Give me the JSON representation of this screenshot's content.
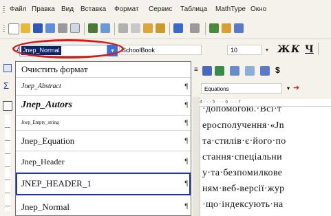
{
  "menu": [
    "Файл",
    "Правка",
    "Вид",
    "Вставка",
    "Формат",
    "Сервис",
    "Таблица",
    "MathType",
    "Окно"
  ],
  "format_bar": {
    "style_value": "Jnep_Normal",
    "font_value": "SchoolBook",
    "size_value": "10",
    "bold": "Ж",
    "italic": "К",
    "underline": "Ч"
  },
  "left_strip_glyph": "Σ",
  "style_list": [
    {
      "label": "Очистить формат",
      "mark": ""
    },
    {
      "label": "Jnep_Abstract",
      "mark": "¶"
    },
    {
      "label": "Jnep_Autors",
      "mark": "¶"
    },
    {
      "label": "Jnep_Empty_string",
      "mark": "¶"
    },
    {
      "label": "Jnep_Equation",
      "mark": "¶"
    },
    {
      "label": "Jnep_Header",
      "mark": "¶"
    },
    {
      "label": "JNEP_HEADER_1",
      "mark": "¶"
    },
    {
      "label": "Jnep_Normal",
      "mark": "¶"
    }
  ],
  "equation_box": "Equations",
  "ruler_text": "4 · · · 5 · · · 6 · · · 7",
  "document_lines": [
    "·допомогою.·Всі·т",
    "еросполучення·«Jn",
    "та·стилів·є·його·по",
    "стання·спеціальни",
    "у·та·безпомилкове",
    "ням·веб-версії·жур",
    "·що·індексують·на"
  ],
  "colors": {
    "selection": "#0a246a",
    "highlight_oval": "#d81818",
    "toolbar_bg": "#f4f2ea"
  }
}
